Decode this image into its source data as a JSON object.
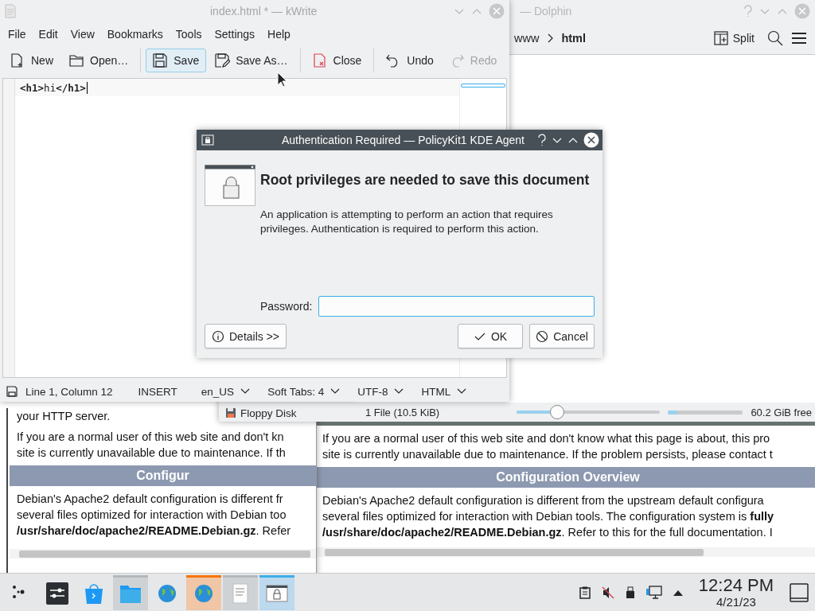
{
  "browsers": [
    {
      "blocks": [
        {
          "kind": "text",
          "text": "your HTTP server."
        },
        {
          "kind": "text",
          "text": "If you are a normal user of this web site and don't kn\nsite is currently unavailable due to maintenance. If th"
        },
        {
          "kind": "heading",
          "text": "Configur"
        },
        {
          "kind": "text",
          "text": "Debian's Apache2 default configuration is different fr\nseveral files optimized for interaction with Debian too\n**/usr/share/doc/apache2/README.Debian.gz**. Refer"
        }
      ]
    },
    {
      "blocks": [
        {
          "kind": "text",
          "text": "If you are a normal user of this web site and don't know what this page is about, this pro\nsite is currently unavailable due to maintenance. If the problem persists, please contact t"
        },
        {
          "kind": "heading",
          "text": "Configuration Overview"
        },
        {
          "kind": "text",
          "text": "Debian's Apache2 default configuration is different from the upstream default configura\nseveral files optimized for interaction with Debian tools. The configuration system is **fully**\n**/usr/share/doc/apache2/README.Debian.gz**. Refer to this for the full documentation. I"
        }
      ]
    }
  ],
  "dolphin": {
    "title": "— Dolphin",
    "active": false,
    "breadcrumb": [
      {
        "label": "www",
        "selected": false
      },
      {
        "label": "html",
        "selected": true
      }
    ],
    "split": "Split",
    "places_item": "Floppy Disk",
    "status": "1 File (10.5 KiB)",
    "zoom": {
      "level": 0.28
    },
    "free_space": {
      "level": 0.12,
      "label": "60.2 GiB free"
    }
  },
  "kwrite": {
    "title": "index.html * — kWrite",
    "active": false,
    "menu": [
      "File",
      "Edit",
      "View",
      "Bookmarks",
      "Tools",
      "Settings",
      "Help"
    ],
    "toolbar": [
      {
        "kind": "new",
        "label": "New",
        "hovered": false,
        "disabled": false
      },
      {
        "kind": "open",
        "label": "Open…",
        "hovered": false,
        "disabled": false
      },
      {
        "kind": "save",
        "label": "Save",
        "hovered": true,
        "disabled": false
      },
      {
        "kind": "saveas",
        "label": "Save As…",
        "hovered": false,
        "disabled": false
      },
      {
        "kind": "close",
        "label": "Close",
        "hovered": false,
        "disabled": false
      },
      {
        "kind": "undo",
        "label": "Undo",
        "hovered": false,
        "disabled": false
      },
      {
        "kind": "redo",
        "label": "Redo",
        "hovered": false,
        "disabled": true
      }
    ],
    "editor_line": "**<h1>**hi**</h1>**",
    "status_bar": {
      "position": "Line 1, Column 12",
      "mode": "INSERT",
      "dropdowns": [
        "en_US",
        "Soft Tabs: 4",
        "UTF-8",
        "HTML"
      ]
    }
  },
  "dialog": {
    "title": "Authentication Required — PolicyKit1 KDE Agent",
    "heading": "Root privileges are needed to save this document",
    "message": "An application is attempting to perform an action that requires privileges. Authentication is required to perform this action.",
    "password_label": "Password:",
    "buttons": [
      {
        "kind": "details",
        "label": "Details >>"
      },
      {
        "kind": "ok",
        "label": "OK"
      },
      {
        "kind": "cancel",
        "label": "Cancel"
      }
    ]
  },
  "taskbar": {
    "items": [
      {
        "kind": "launcher",
        "open": false,
        "attention": false,
        "selected": false
      },
      {
        "kind": "settings",
        "open": false,
        "attention": false,
        "selected": false
      },
      {
        "kind": "store",
        "open": false,
        "attention": false,
        "selected": false
      },
      {
        "kind": "files",
        "open": true,
        "attention": false,
        "selected": false
      },
      {
        "kind": "browser",
        "open": false,
        "attention": false,
        "selected": false
      },
      {
        "kind": "browser",
        "open": true,
        "attention": true,
        "selected": false
      },
      {
        "kind": "editor",
        "open": true,
        "attention": false,
        "selected": false
      },
      {
        "kind": "lock",
        "open": true,
        "attention": false,
        "selected": true
      }
    ],
    "clock": "12:24 PM",
    "date": "4/21/23"
  }
}
